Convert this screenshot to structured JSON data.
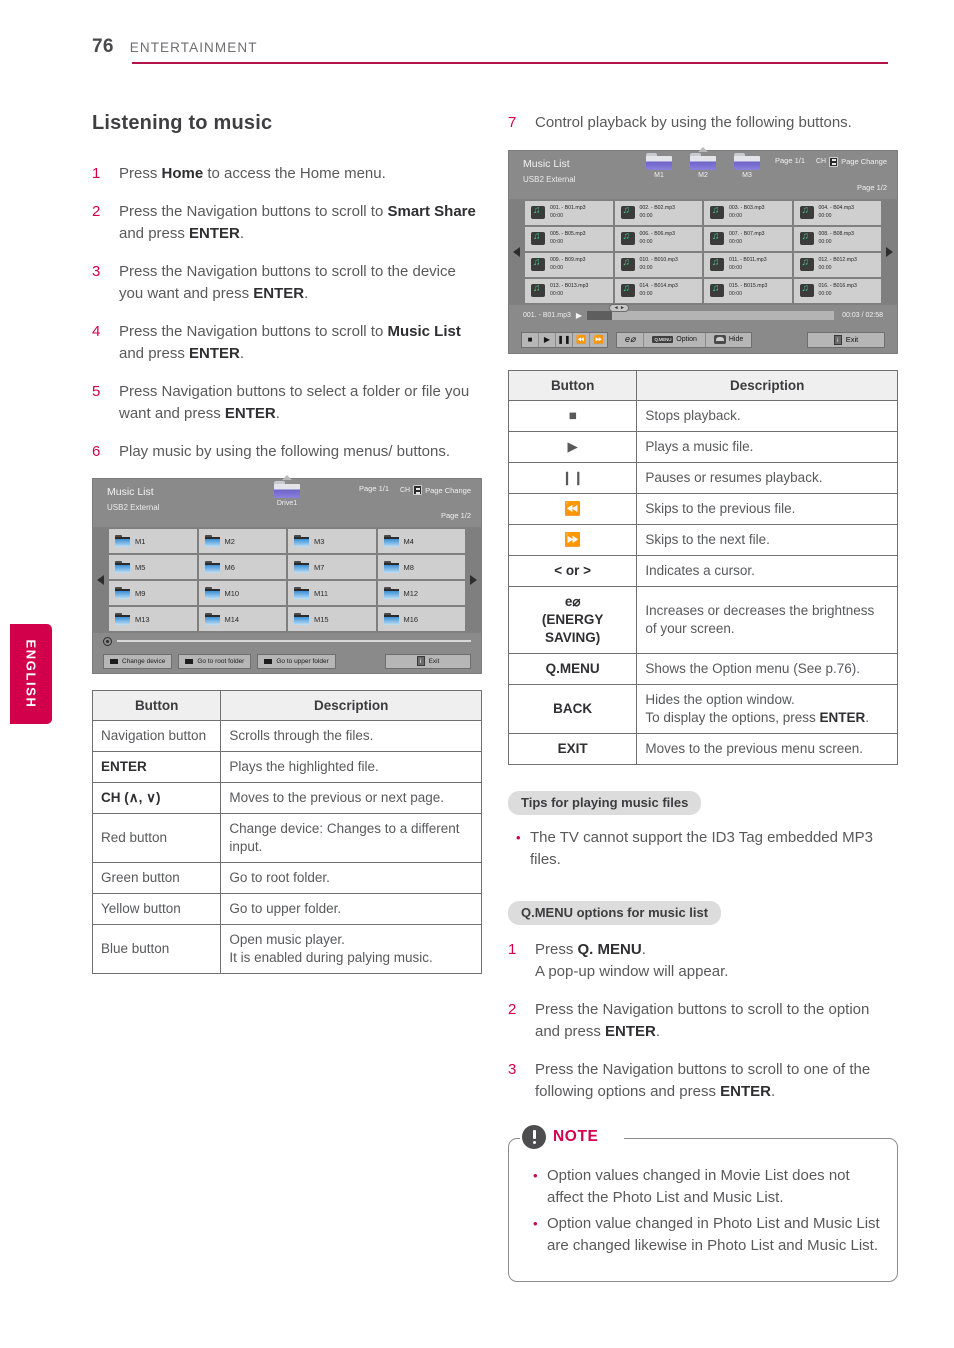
{
  "header": {
    "page_number": "76",
    "section": "ENTERTAINMENT"
  },
  "language_tab": {
    "label": "ENGLISH"
  },
  "left": {
    "title": "Listening to music",
    "steps": [
      {
        "num": "1",
        "html": "Press <b>Home</b> to access the Home menu."
      },
      {
        "num": "2",
        "html": "Press the Navigation buttons to scroll to <b>Smart Share</b> and press <b>ENTER</b>."
      },
      {
        "num": "3",
        "html": "Press the Navigation buttons to scroll to the device you want and press <b>ENTER</b>."
      },
      {
        "num": "4",
        "html": "Press the Navigation buttons to scroll to <b>Music List</b> and press <b>ENTER</b>."
      },
      {
        "num": "5",
        "html": "Press Navigation buttons to select a folder or file you want and press <b>ENTER</b>."
      },
      {
        "num": "6",
        "html": "Play music by using the following menus/ buttons."
      }
    ],
    "tv": {
      "title": "Music List",
      "subtitle": "USB2 External",
      "page_top": "Page 1/1",
      "page_bottom": "Page 1/2",
      "page_change": "Page Change",
      "folder_label": "Drive1",
      "cells": [
        "M1",
        "M2",
        "M3",
        "M4",
        "M5",
        "M6",
        "M7",
        "M8",
        "M9",
        "M10",
        "M11",
        "M12",
        "M13",
        "M14",
        "M15",
        "M16"
      ],
      "buttons": [
        "Change device",
        "Go to root folder",
        "Go to upper folder"
      ],
      "exit": "Exit"
    },
    "table": {
      "headers": [
        "Button",
        "Description"
      ],
      "rows": [
        {
          "button": "Navigation button",
          "desc": "Scrolls through the files."
        },
        {
          "button": "ENTER",
          "desc": "Plays the highlighted file.",
          "bold": true
        },
        {
          "button": "CH (∧, ∨)",
          "desc": "Moves to the previous or next page.",
          "bold": true
        },
        {
          "button": "Red button",
          "desc": "Change device: Changes to a different input."
        },
        {
          "button": "Green button",
          "desc": "Go to root folder."
        },
        {
          "button": "Yellow button",
          "desc": "Go to upper folder."
        },
        {
          "button": "Blue button",
          "desc": "Open music player.\nIt is enabled during palying music."
        }
      ]
    }
  },
  "right": {
    "step7": {
      "num": "7",
      "html": "Control playback by using the following buttons."
    },
    "tv": {
      "title": "Music List",
      "subtitle": "USB2 External",
      "page_top": "Page 1/1",
      "page_bottom": "Page 1/2",
      "page_change": "Page Change",
      "folders": [
        "M1",
        "M2",
        "M3"
      ],
      "files": [
        {
          "name": "001. - B01.mp3",
          "time": "00:00"
        },
        {
          "name": "002. - B02.mp3",
          "time": "00:00"
        },
        {
          "name": "003. - B03.mp3",
          "time": "00:00"
        },
        {
          "name": "004. - B04.mp3",
          "time": "00:00"
        },
        {
          "name": "005. - B05.mp3",
          "time": "00:00"
        },
        {
          "name": "006. - B06.mp3",
          "time": "00:00"
        },
        {
          "name": "007. - B07.mp3",
          "time": "00:00"
        },
        {
          "name": "008. - B08.mp3",
          "time": "00:00"
        },
        {
          "name": "009. - B09.mp3",
          "time": "00:00"
        },
        {
          "name": "010. - B010.mp3",
          "time": "00:00"
        },
        {
          "name": "011. - B011.mp3",
          "time": "00:00"
        },
        {
          "name": "012. - B012.mp3",
          "time": "00:00"
        },
        {
          "name": "013. - B013.mp3",
          "time": "00:00"
        },
        {
          "name": "014. - B014.mp3",
          "time": "00:00"
        },
        {
          "name": "015. - B015.mp3",
          "time": "00:00"
        },
        {
          "name": "016. - B016.mp3",
          "time": "00:00"
        }
      ],
      "now_playing": "001. - B01.mp3",
      "elapsed_total": "00:03 / 02:58",
      "knob_label": "◄ ►",
      "option_label": "Option",
      "hide_label": "Hide",
      "qmenu_key": "Q.MENU",
      "exit": "Exit"
    },
    "table": {
      "headers": [
        "Button",
        "Description"
      ],
      "rows": [
        {
          "button": "■",
          "desc": "Stops playback.",
          "sym": true
        },
        {
          "button": "▶",
          "desc": "Plays a music file.",
          "sym": true
        },
        {
          "button": "❙❙",
          "desc": "Pauses or resumes playback.",
          "sym": true
        },
        {
          "button": "⏪",
          "desc": "Skips to the previous file.",
          "sym": true
        },
        {
          "button": "⏩",
          "desc": "Skips to the next file.",
          "sym": true
        },
        {
          "button": "< or >",
          "desc": "Indicates a cursor.",
          "bold": true
        },
        {
          "button": "e⌀\n(ENERGY SAVING)",
          "desc": "Increases or decreases the brightness of your screen.",
          "bold": true
        },
        {
          "button": "Q.MENU",
          "desc": "Shows the Option menu (See p.76).",
          "bold": true
        },
        {
          "button": "BACK",
          "desc": "Hides the option window.\nTo display the options, press ENTER.",
          "bold": true
        },
        {
          "button": "EXIT",
          "desc": "Moves to the previous menu screen.",
          "bold": true
        }
      ]
    },
    "tips": {
      "pill": "Tips for playing music files",
      "items": [
        "The TV cannot support the ID3 Tag embedded MP3 files."
      ]
    },
    "qmenu": {
      "pill": "Q.MENU options for music list",
      "steps": [
        {
          "num": "1",
          "html": "Press <b>Q. MENU</b>.<span class=\"step-sub\">A pop-up window will appear.</span>"
        },
        {
          "num": "2",
          "html": "Press the Navigation buttons to scroll to the option and press <b>ENTER</b>."
        },
        {
          "num": "3",
          "html": "Press the Navigation buttons to scroll to one of the following options and press <b>ENTER</b>."
        }
      ]
    },
    "note": {
      "title": "NOTE",
      "items": [
        "Option values changed in Movie List does not affect the Photo List and Music List.",
        "Option value changed in Photo List and Music List are changed likewise in Photo List and Music List."
      ]
    }
  },
  "colors": {
    "accent": "#d2004b",
    "rule": "#b5124a",
    "tv_bg": "#8a8a8a",
    "cell": "#cfcfcf"
  }
}
